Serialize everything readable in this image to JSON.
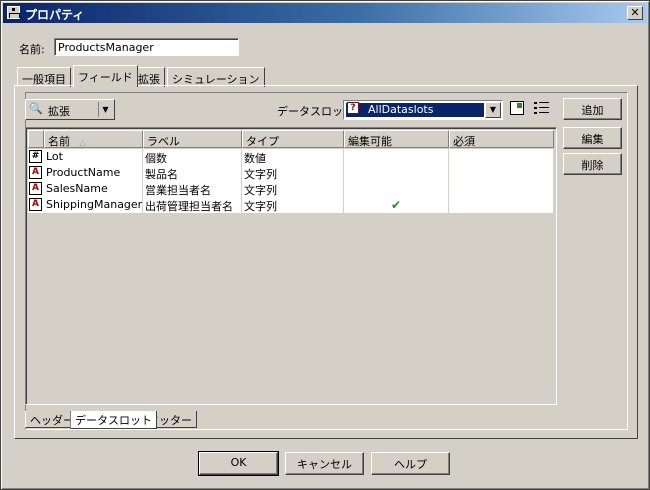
{
  "window": {
    "title": "プロパティ",
    "close_glyph": "✕"
  },
  "name_field": {
    "label": "名前:",
    "value": "ProductsManager"
  },
  "tabs": [
    "一般項目",
    "フィールド",
    "拡張",
    "シミュレーション"
  ],
  "toolbar": {
    "filter_label": "拡張",
    "dataslot_label": "データスロット",
    "dataslot_value": "AllDataslots"
  },
  "side_buttons": {
    "add": "追加",
    "edit": "編集",
    "delete": "削除"
  },
  "grid": {
    "columns": [
      "名前",
      "ラベル",
      "タイプ",
      "編集可能",
      "必須"
    ],
    "rows": [
      {
        "type_icon": "#",
        "name": "Lot",
        "label": "個数",
        "type": "数値",
        "editable": "",
        "required": ""
      },
      {
        "type_icon": "A",
        "name": "ProductName",
        "label": "製品名",
        "type": "文字列",
        "editable": "",
        "required": ""
      },
      {
        "type_icon": "A",
        "name": "SalesName",
        "label": "営業担当者名",
        "type": "文字列",
        "editable": "",
        "required": ""
      },
      {
        "type_icon": "A",
        "name": "ShippingManager...",
        "label": "出荷管理担当者名",
        "type": "文字列",
        "editable": "✔",
        "required": ""
      }
    ]
  },
  "bottom_tabs": [
    "ヘッダー",
    "データスロット",
    "フッター"
  ],
  "footer_buttons": {
    "ok": "OK",
    "cancel": "キャンセル",
    "help": "ヘルプ"
  },
  "colors": {
    "titlebar": "#0a246a",
    "selection": "#0a246a",
    "check": "#2a8a2a",
    "string_icon": "#b00000"
  }
}
